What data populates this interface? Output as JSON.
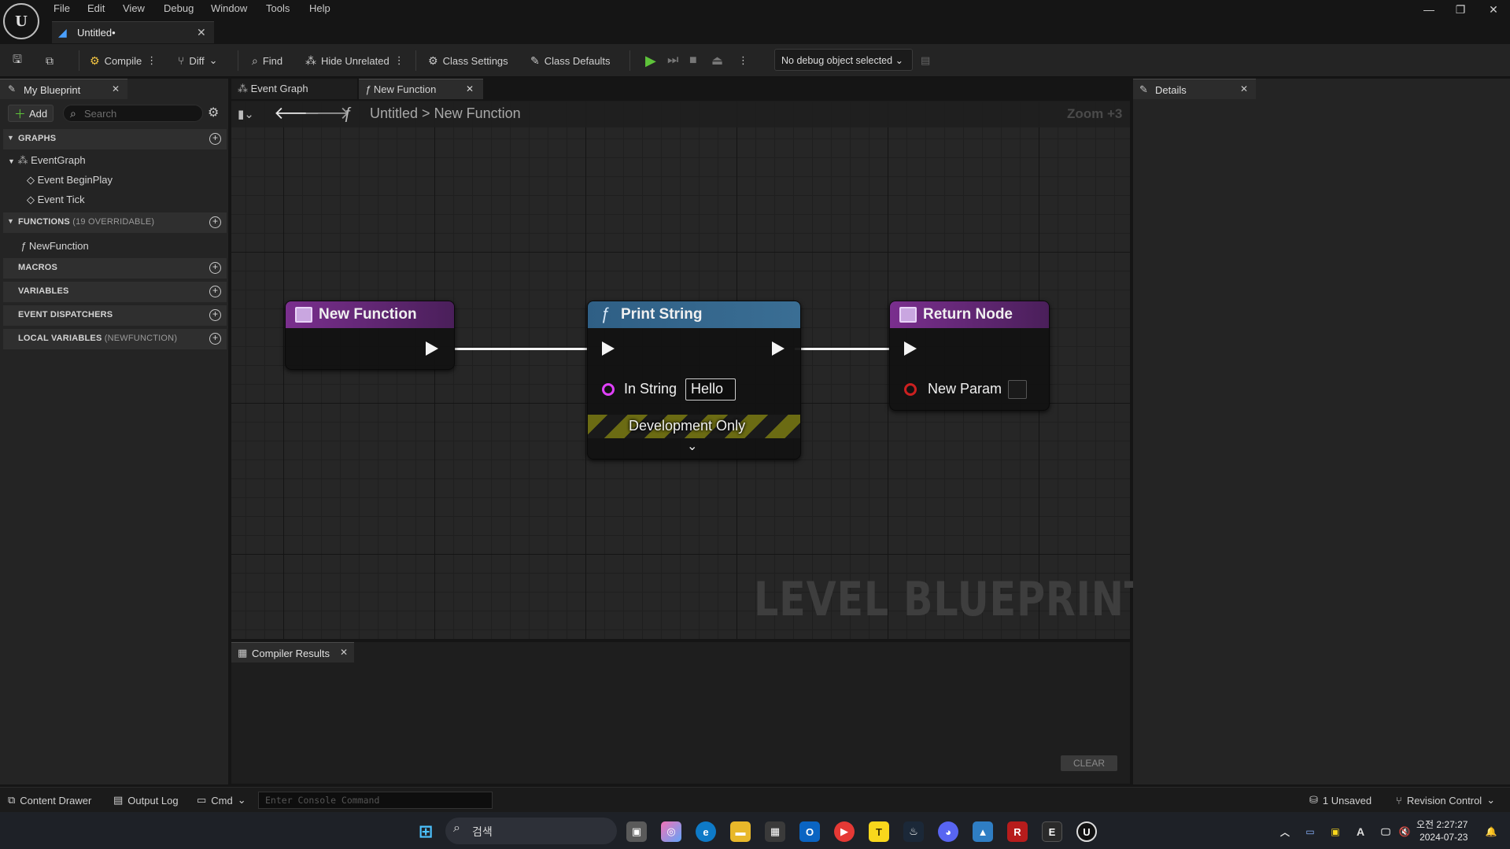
{
  "menu": [
    "File",
    "Edit",
    "View",
    "Debug",
    "Window",
    "Tools",
    "Help"
  ],
  "document_tab": "Untitled•",
  "toolbar": {
    "compile": "Compile",
    "diff": "Diff",
    "find": "Find",
    "hide_unrelated": "Hide Unrelated",
    "class_settings": "Class Settings",
    "class_defaults": "Class Defaults",
    "debug_object": "No debug object selected"
  },
  "my_blueprint": {
    "tab": "My Blueprint",
    "add": "Add",
    "search_placeholder": "Search",
    "graphs_header": "GRAPHS",
    "graphs": [
      "EventGraph",
      "Event BeginPlay",
      "Event Tick"
    ],
    "functions_header": "FUNCTIONS",
    "functions_sub": "(19 OVERRIDABLE)",
    "functions": [
      "NewFunction"
    ],
    "macros_header": "MACROS",
    "variables_header": "VARIABLES",
    "dispatchers_header": "EVENT DISPATCHERS",
    "local_vars_header": "LOCAL VARIABLES",
    "local_vars_sub": "(NEWFUNCTION)"
  },
  "center_tabs": [
    "Event Graph",
    "New Function"
  ],
  "breadcrumb": {
    "root": "Untitled",
    "separator": ">",
    "current": "New Function"
  },
  "zoom": "Zoom +3",
  "watermark": "LEVEL BLUEPRINT",
  "nodes": {
    "entry": {
      "title": "New Function"
    },
    "print": {
      "title": "Print String",
      "in_string_label": "In String",
      "in_string_value": "Hello",
      "dev_only": "Development Only"
    },
    "return": {
      "title": "Return Node",
      "param_label": "New Param"
    }
  },
  "compiler": {
    "tab": "Compiler Results",
    "clear": "CLEAR"
  },
  "details": {
    "tab": "Details"
  },
  "statusbar": {
    "content_drawer": "Content Drawer",
    "output_log": "Output Log",
    "cmd": "Cmd",
    "console_placeholder": "Enter Console Command",
    "unsaved": "1 Unsaved",
    "revision": "Revision Control"
  },
  "taskbar": {
    "search": "검색",
    "time": "오전 2:27:27",
    "date": "2024-07-23"
  },
  "colors": {
    "function_node": "#7a2f8e",
    "print_node": "#2f5f85",
    "exec_wire": "#f4f4f4",
    "string_pin": "#e040fb",
    "bool_pin": "#cc2020"
  }
}
